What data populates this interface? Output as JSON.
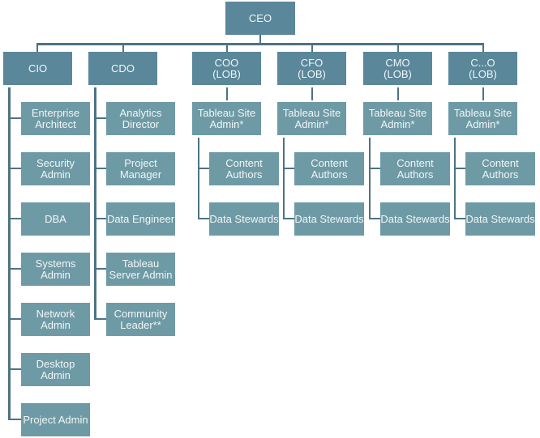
{
  "colors": {
    "executive": "#5a879a",
    "role": "#6e9aa5",
    "connector": "#4d7384"
  },
  "ceo": "CEO",
  "cio": {
    "title": "CIO",
    "reports": [
      "Enterprise Architect",
      "Security Admin",
      "DBA",
      "Systems Admin",
      "Network Admin",
      "Desktop Admin",
      "Project Admin"
    ]
  },
  "cdo": {
    "title": "CDO",
    "reports": [
      "Analytics Director",
      "Project Manager",
      "Data Engineer",
      "Tableau Server Admin",
      "Community Leader**"
    ]
  },
  "lobs": [
    {
      "title": "COO\n(LOB)",
      "site_admin": "Tableau Site Admin*",
      "reports": [
        "Content Authors",
        "Data Stewards"
      ]
    },
    {
      "title": "CFO\n(LOB)",
      "site_admin": "Tableau Site Admin*",
      "reports": [
        "Content Authors",
        "Data Stewards"
      ]
    },
    {
      "title": "CMO\n(LOB)",
      "site_admin": "Tableau Site Admin*",
      "reports": [
        "Content Authors",
        "Data Stewards"
      ]
    },
    {
      "title": "C...O\n(LOB)",
      "site_admin": "Tableau Site Admin*",
      "reports": [
        "Content Authors",
        "Data Stewards"
      ]
    }
  ]
}
